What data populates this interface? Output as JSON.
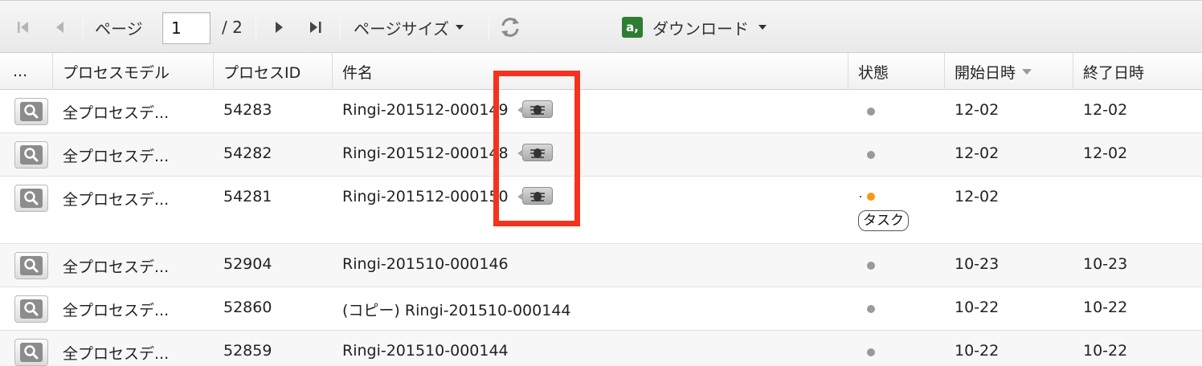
{
  "toolbar": {
    "page_label": "ページ",
    "page_value": "1",
    "page_total": "/ 2",
    "page_size_label": "ページサイズ",
    "download_icon_text": "a,",
    "download_label": "ダウンロード"
  },
  "columns": {
    "menu": "...",
    "process_model": "プロセスモデル",
    "process_id": "プロセスID",
    "subject": "件名",
    "status": "状態",
    "start": "開始日時",
    "end": "終了日時"
  },
  "rows": [
    {
      "model": "全プロセスデ...",
      "id": "54283",
      "subject": "Ringi-201512-000149",
      "start": "12-02",
      "end": "12-02"
    },
    {
      "model": "全プロセスデ...",
      "id": "54282",
      "subject": "Ringi-201512-000148",
      "start": "12-02",
      "end": "12-02"
    },
    {
      "model": "全プロセスデ...",
      "id": "54281",
      "subject": "Ringi-201512-000150",
      "start": "12-02",
      "end": "",
      "task_label": "タスク"
    },
    {
      "model": "全プロセスデ...",
      "id": "52904",
      "subject": "Ringi-201510-000146",
      "start": "10-23",
      "end": "10-23"
    },
    {
      "model": "全プロセスデ...",
      "id": "52860",
      "subject": "(コピー) Ringi-201510-000144",
      "start": "10-22",
      "end": "10-22"
    },
    {
      "model": "全プロセスデ...",
      "id": "52859",
      "subject": "Ringi-201510-000144",
      "start": "10-22",
      "end": "10-22"
    }
  ],
  "colors": {
    "highlight": "#f5321e",
    "status_dot": "#9a9a9a",
    "active_dot": "#f39c12",
    "download_icon": "#2e7d32"
  }
}
